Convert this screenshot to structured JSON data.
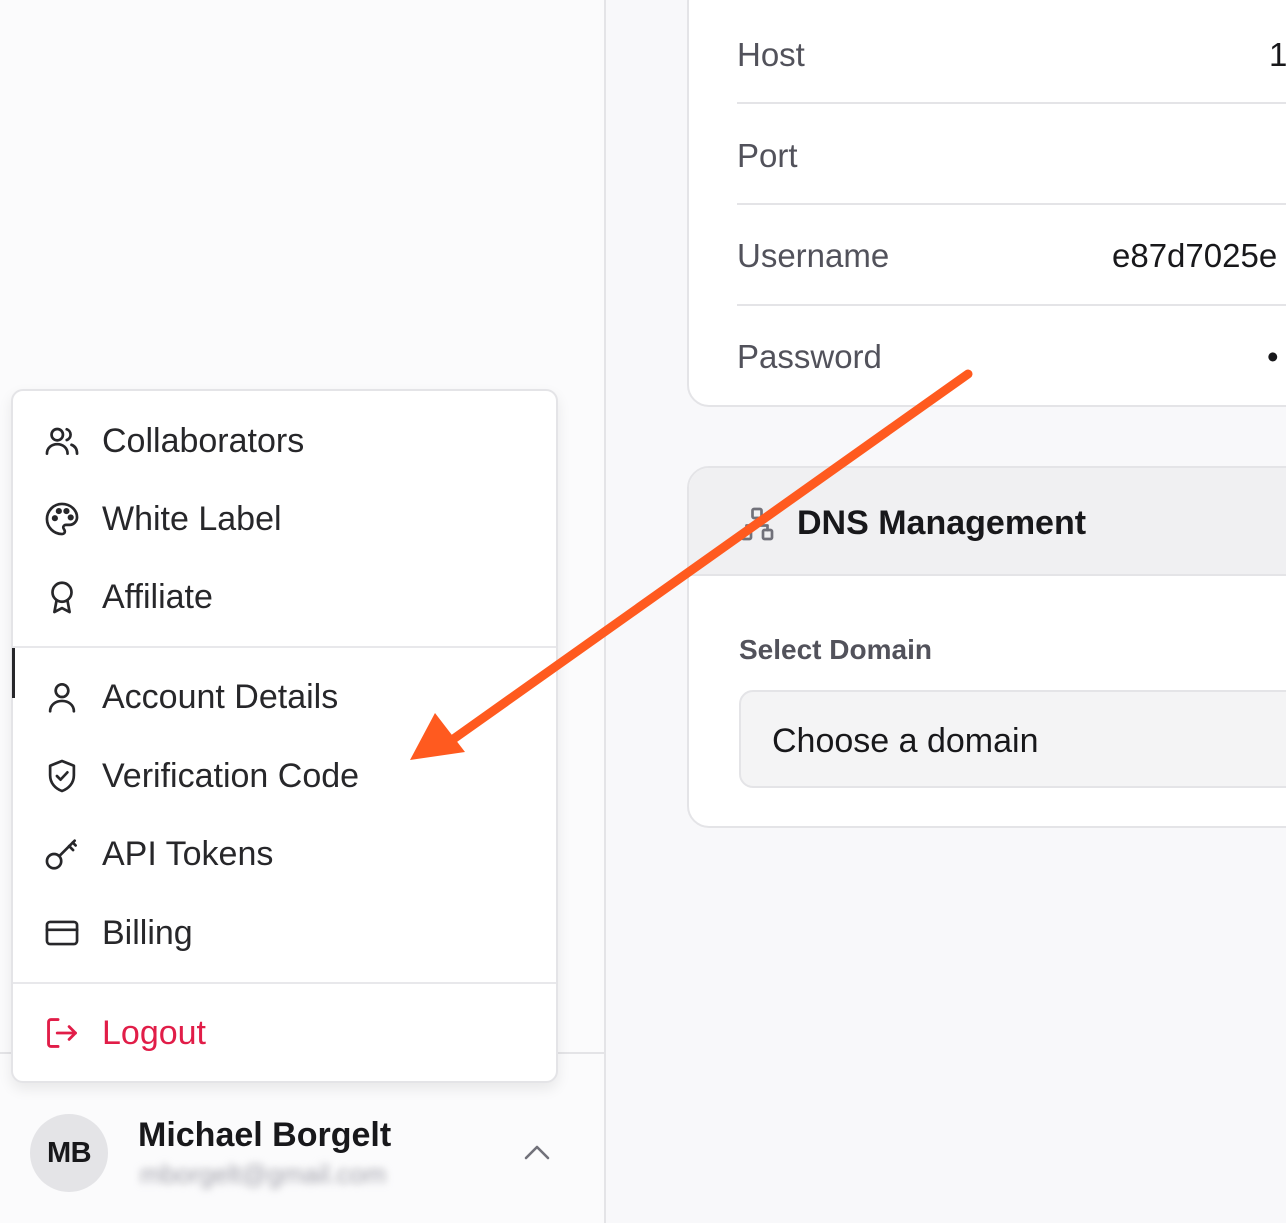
{
  "menu": {
    "items_group1": [
      {
        "label": "Collaborators",
        "icon": "users-icon"
      },
      {
        "label": "White Label",
        "icon": "palette-icon"
      },
      {
        "label": "Affiliate",
        "icon": "award-icon"
      }
    ],
    "items_group2": [
      {
        "label": "Account Details",
        "icon": "user-icon"
      },
      {
        "label": "Verification Code",
        "icon": "shield-check-icon"
      },
      {
        "label": "API Tokens",
        "icon": "key-icon"
      },
      {
        "label": "Billing",
        "icon": "credit-card-icon"
      }
    ],
    "logout": {
      "label": "Logout",
      "icon": "logout-icon"
    }
  },
  "user": {
    "initials": "MB",
    "name": "Michael Borgelt",
    "email": "mborgelt@gmail.com"
  },
  "connection": {
    "rows": [
      {
        "key": "Host",
        "value": "1"
      },
      {
        "key": "Port",
        "value": ""
      },
      {
        "key": "Username",
        "value": "e87d7025e"
      },
      {
        "key": "Password",
        "value": "•"
      }
    ]
  },
  "dns": {
    "title": "DNS Management",
    "select_label": "Select Domain",
    "select_value": "Choose a domain"
  },
  "colors": {
    "accent_arrow": "#ff5a1f",
    "logout": "#e11d48"
  }
}
